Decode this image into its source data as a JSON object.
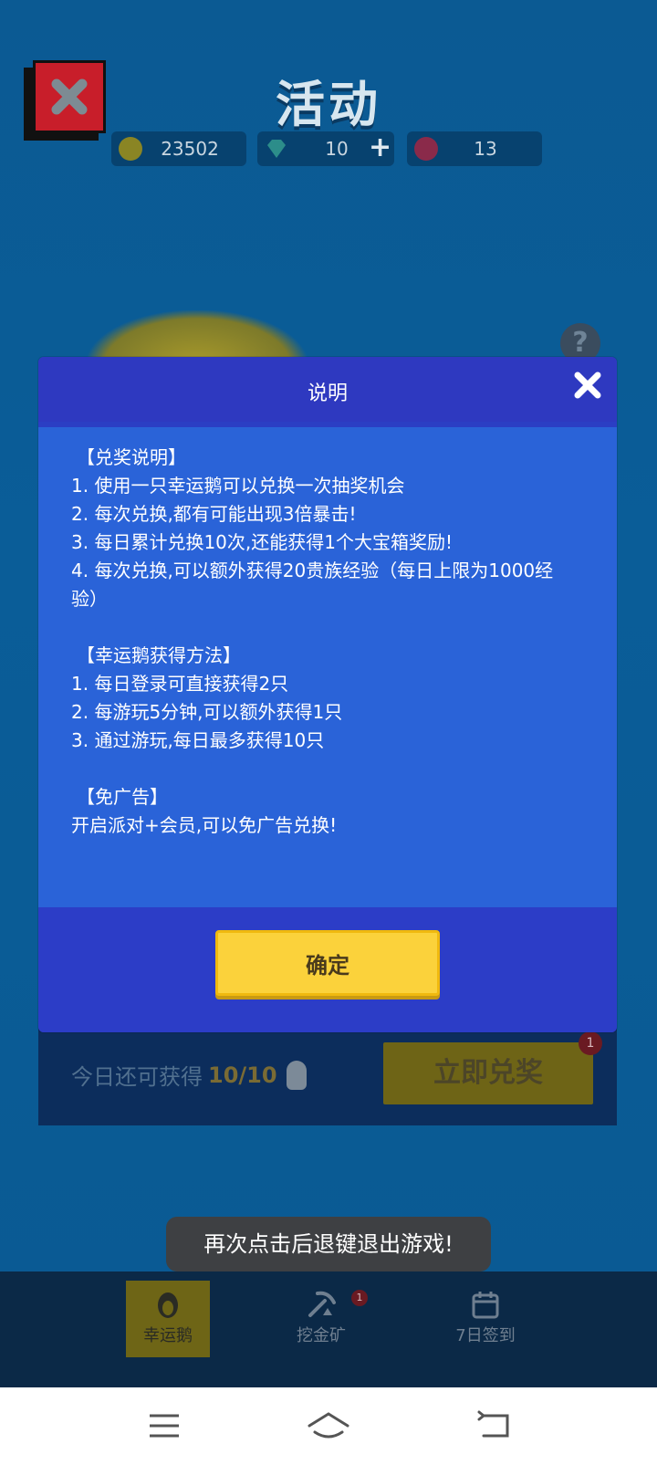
{
  "header": {
    "title": "活动",
    "coins": "23502",
    "gems": "10",
    "tickets": "13",
    "plus": "+"
  },
  "help": {
    "symbol": "?"
  },
  "redeem_panel": {
    "remaining_label": "今日还可获得",
    "remaining_count": "10/10",
    "redeem_button": "立即兑奖",
    "badge": "1"
  },
  "modal": {
    "title": "说明",
    "sections": [
      {
        "heading": "【兑奖说明】",
        "lines": [
          "1. 使用一只幸运鹅可以兑换一次抽奖机会",
          "2. 每次兑换,都有可能出现3倍暴击!",
          "3. 每日累计兑换10次,还能获得1个大宝箱奖励!",
          "4. 每次兑换,可以额外获得20贵族经验（每日上限为1000经",
          "验）"
        ]
      },
      {
        "heading": "【幸运鹅获得方法】",
        "lines": [
          "1. 每日登录可直接获得2只",
          "2. 每游玩5分钟,可以额外获得1只",
          "3. 通过游玩,每日最多获得10只"
        ]
      },
      {
        "heading": "【免广告】",
        "lines": [
          "开启派对+会员,可以免广告兑换!"
        ]
      }
    ],
    "confirm_label": "确定"
  },
  "toast": "再次点击后退键退出游戏!",
  "bottom_nav": {
    "tabs": [
      {
        "label": "幸运鹅",
        "icon": "goose-icon",
        "active": true
      },
      {
        "label": "挖金矿",
        "icon": "pickaxe-icon",
        "active": false,
        "badge": "1"
      },
      {
        "label": "7日签到",
        "icon": "calendar-icon",
        "active": false
      }
    ]
  },
  "colors": {
    "modal_bg": "#2a63d8",
    "modal_frame": "#2b3ec4",
    "confirm_yellow": "#fbd23b",
    "app_bg": "#0b5a93"
  }
}
